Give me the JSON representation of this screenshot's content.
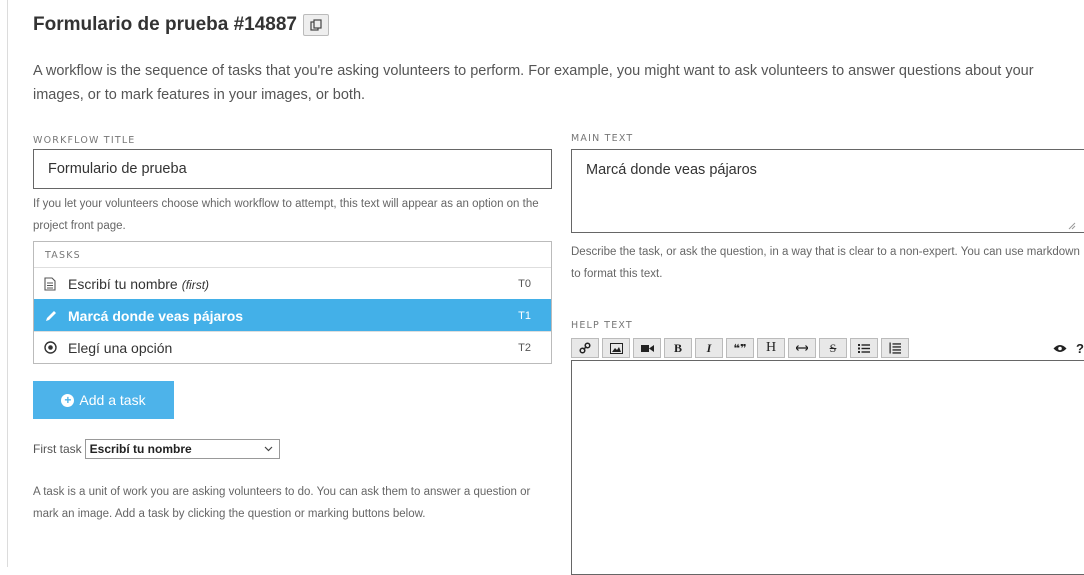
{
  "header": {
    "title": "Formulario de prueba #14887"
  },
  "intro_text": "A workflow is the sequence of tasks that you're asking volunteers to perform. For example, you might want to ask volunteers to answer questions about your images, or to mark features in your images, or both.",
  "workflow_title": {
    "label": "WORKFLOW TITLE",
    "value": "Formulario de prueba",
    "hint": "If you let your volunteers choose which workflow to attempt, this text will appear as an option on the project front page."
  },
  "tasks": {
    "label": "TASKS",
    "items": [
      {
        "name": "Escribí tu nombre",
        "suffix": "(first)",
        "key": "T0",
        "icon": "text-task-icon",
        "active": false
      },
      {
        "name": "Marcá donde veas pájaros",
        "suffix": "",
        "key": "T1",
        "icon": "pencil-icon",
        "active": true
      },
      {
        "name": "Elegí una opción",
        "suffix": "",
        "key": "T2",
        "icon": "radio-question-icon",
        "active": false
      }
    ],
    "add_label": "Add a task"
  },
  "first_task": {
    "label": "First task",
    "selected": "Escribí tu nombre"
  },
  "task_description": "A task is a unit of work you are asking volunteers to do. You can ask them to answer a question or mark an image. Add a task by clicking the question or marking buttons below.",
  "main_text": {
    "label": "MAIN TEXT",
    "value": "Marcá donde veas pájaros",
    "hint": "Describe the task, or ask the question, in a way that is clear to a non-expert. You can use markdown to format this text."
  },
  "help_text": {
    "label": "HELP TEXT",
    "toolbar": {
      "bold": "B",
      "italic": "I",
      "quote": "❝❞",
      "heading": "H",
      "strike": "S",
      "help": "?"
    },
    "value": ""
  },
  "colors": {
    "accent": "#43b0e8",
    "button": "#4db3ea"
  }
}
